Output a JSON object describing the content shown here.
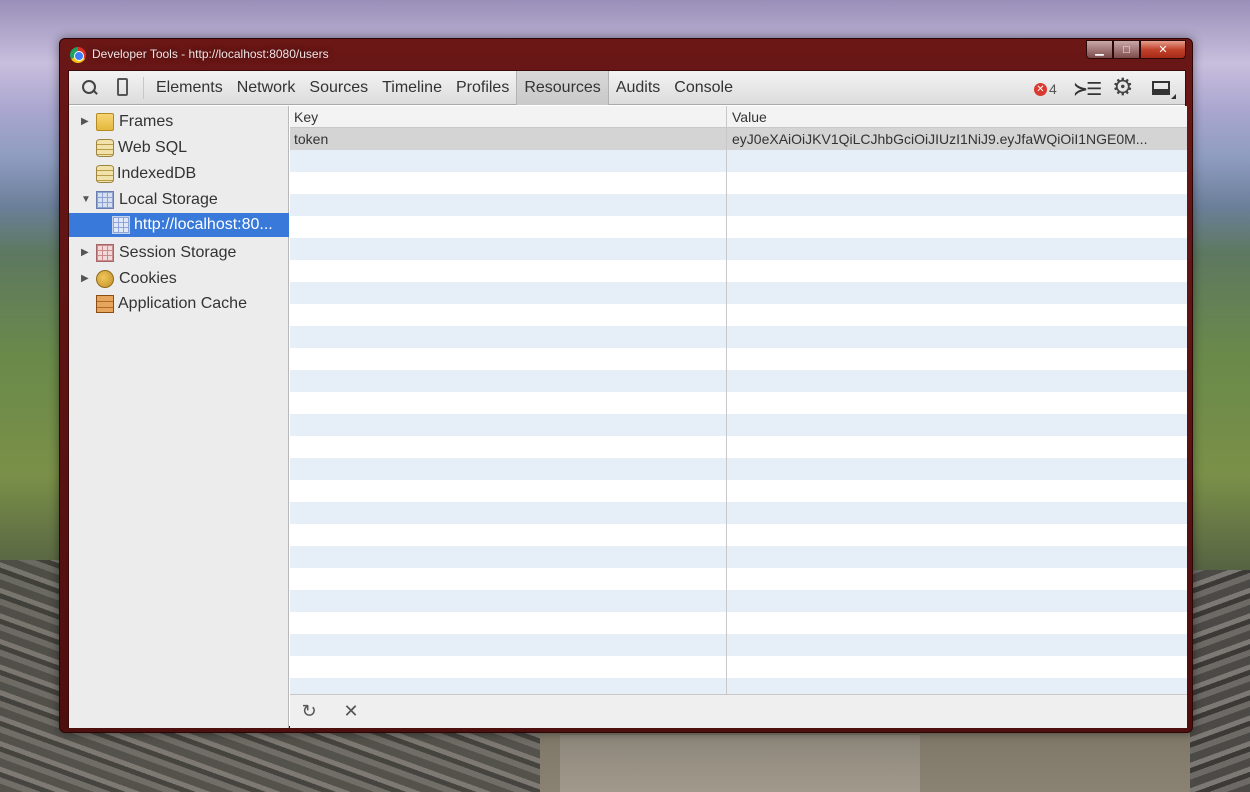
{
  "window": {
    "title": "Developer Tools - http://localhost:8080/users"
  },
  "toolbar": {
    "tabs": [
      {
        "label": "Elements"
      },
      {
        "label": "Network"
      },
      {
        "label": "Sources"
      },
      {
        "label": "Timeline"
      },
      {
        "label": "Profiles"
      },
      {
        "label": "Resources",
        "active": true
      },
      {
        "label": "Audits"
      },
      {
        "label": "Console"
      }
    ],
    "error_count": "4"
  },
  "sidebar": {
    "items": [
      {
        "label": "Frames",
        "icon": "folder-icon",
        "expandable": true
      },
      {
        "label": "Web SQL",
        "icon": "database-icon"
      },
      {
        "label": "IndexedDB",
        "icon": "database-icon"
      },
      {
        "label": "Local Storage",
        "icon": "storage-grid-icon",
        "expanded": true
      },
      {
        "label": "http://localhost:80...",
        "icon": "storage-grid-icon",
        "selected": true
      },
      {
        "label": "Session Storage",
        "icon": "storage-grid-icon",
        "expandable": true
      },
      {
        "label": "Cookies",
        "icon": "cookie-icon",
        "expandable": true
      },
      {
        "label": "Application Cache",
        "icon": "cache-icon"
      }
    ]
  },
  "table": {
    "columns": [
      "Key",
      "Value"
    ],
    "rows": [
      {
        "key": "token",
        "value": "eyJ0eXAiOiJKV1QiLCJhbGciOiJIUzI1NiJ9.eyJfaWQiOiI1NGE0M..."
      }
    ]
  },
  "colors": {
    "window_frame": "#6a1716",
    "selection": "#3879d9",
    "row_stripe": "#e6eef8"
  }
}
